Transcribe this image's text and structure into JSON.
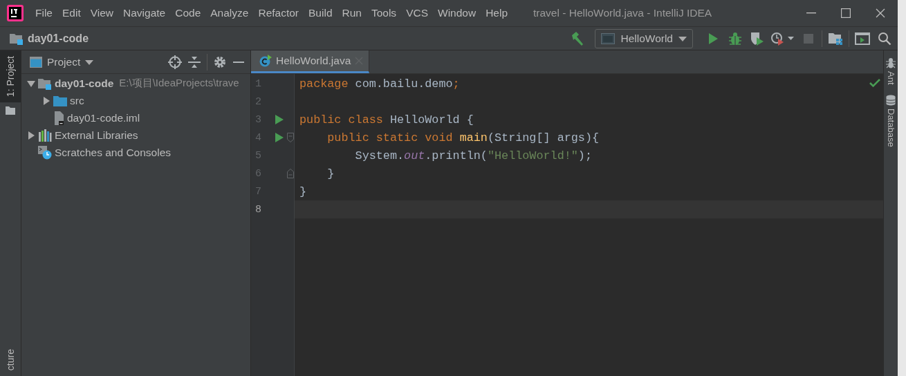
{
  "window": {
    "title": "travel - HelloWorld.java - IntelliJ IDEA"
  },
  "menu": [
    "File",
    "Edit",
    "View",
    "Navigate",
    "Code",
    "Analyze",
    "Refactor",
    "Build",
    "Run",
    "Tools",
    "VCS",
    "Window",
    "Help"
  ],
  "navigation_bar": {
    "breadcrumb": "day01-code"
  },
  "toolbar": {
    "run_configuration": "HelloWorld",
    "stop": {
      "disabled": true
    }
  },
  "left_stripe": {
    "top_tabs": [
      {
        "label": "1: Project",
        "selected": true
      }
    ],
    "bottom_tabs": [
      {
        "label": "cture",
        "selected": false
      }
    ]
  },
  "project_panel": {
    "title": "Project",
    "tree": [
      {
        "label": "day01-code",
        "path": "E:\\项目\\IdeaProjects\\trave",
        "kind": "module",
        "expanded": true,
        "children": [
          {
            "label": "src",
            "kind": "folder",
            "expanded": false
          },
          {
            "label": "day01-code.iml",
            "kind": "file"
          }
        ]
      },
      {
        "label": "External Libraries",
        "kind": "libraries",
        "expanded": false
      },
      {
        "label": "Scratches and Consoles",
        "kind": "scratches"
      }
    ]
  },
  "editor": {
    "tabs": [
      {
        "label": "HelloWorld.java",
        "selected": true
      }
    ],
    "inspection_ok": true,
    "lines": [
      {
        "number": "1",
        "run": false,
        "current": false,
        "fold_start": false,
        "fold_end": false,
        "tokens": [
          {
            "text": "package ",
            "kind": "keyword"
          },
          {
            "text": "com.bailu.demo",
            "kind": "plain"
          },
          {
            "text": ";",
            "kind": "keyword"
          }
        ]
      },
      {
        "number": "2",
        "run": false,
        "current": false,
        "fold_start": false,
        "fold_end": false
      },
      {
        "number": "3",
        "run": true,
        "current": false,
        "fold_start": false,
        "fold_end": false,
        "tokens": [
          {
            "text": "public class ",
            "kind": "keyword"
          },
          {
            "text": "HelloWorld {",
            "kind": "plain"
          }
        ]
      },
      {
        "number": "4",
        "run": true,
        "current": false,
        "fold_start": true,
        "fold_end": false,
        "tokens": [
          {
            "text": "    public static void ",
            "kind": "keyword"
          },
          {
            "text": "main",
            "kind": "method"
          },
          {
            "text": "(String[] args){",
            "kind": "plain"
          }
        ]
      },
      {
        "number": "5",
        "run": false,
        "current": false,
        "fold_start": false,
        "fold_end": false,
        "tokens": [
          {
            "text": "        System.",
            "kind": "plain"
          },
          {
            "text": "out",
            "kind": "field"
          },
          {
            "text": ".println(",
            "kind": "plain"
          },
          {
            "text": "\"HelloWorld!\"",
            "kind": "string"
          },
          {
            "text": ");",
            "kind": "plain"
          }
        ]
      },
      {
        "number": "6",
        "run": false,
        "current": false,
        "fold_start": false,
        "fold_end": true,
        "tokens": [
          {
            "text": "    }",
            "kind": "plain"
          }
        ]
      },
      {
        "number": "7",
        "run": false,
        "current": false,
        "fold_start": false,
        "fold_end": false,
        "tokens": [
          {
            "text": "}",
            "kind": "plain"
          }
        ]
      },
      {
        "number": "8",
        "run": false,
        "current": true,
        "fold_start": false,
        "fold_end": false
      }
    ]
  },
  "right_stripe": {
    "tabs": [
      {
        "label": "Ant",
        "kind": "ant"
      },
      {
        "label": "Database",
        "kind": "database"
      }
    ]
  }
}
